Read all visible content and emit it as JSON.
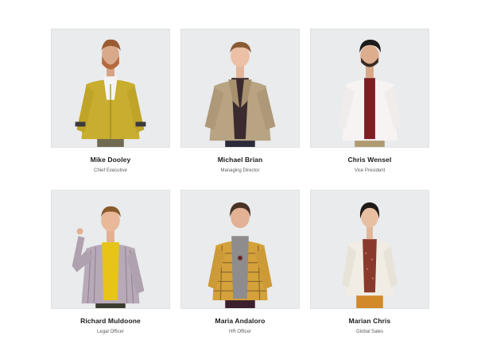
{
  "team": {
    "members": [
      {
        "name": "Mike Dooley",
        "role": "Chief Executive",
        "photo_icon": "person-portrait-icon"
      },
      {
        "name": "Michael Brian",
        "role": "Managing Director",
        "photo_icon": "person-portrait-icon"
      },
      {
        "name": "Chris Wensel",
        "role": "Vice President",
        "photo_icon": "person-portrait-icon"
      },
      {
        "name": "Richard Muldoone",
        "role": "Legal Officer",
        "photo_icon": "person-portrait-icon"
      },
      {
        "name": "Maria Andaloro",
        "role": "HR Officer",
        "photo_icon": "person-portrait-icon"
      },
      {
        "name": "Marian Chris",
        "role": "Global Sales",
        "photo_icon": "person-portrait-icon"
      }
    ]
  },
  "colors": {
    "photo_background": "#e9ebec",
    "name_text": "#1b1b1b",
    "role_text": "#5d5d5d"
  }
}
